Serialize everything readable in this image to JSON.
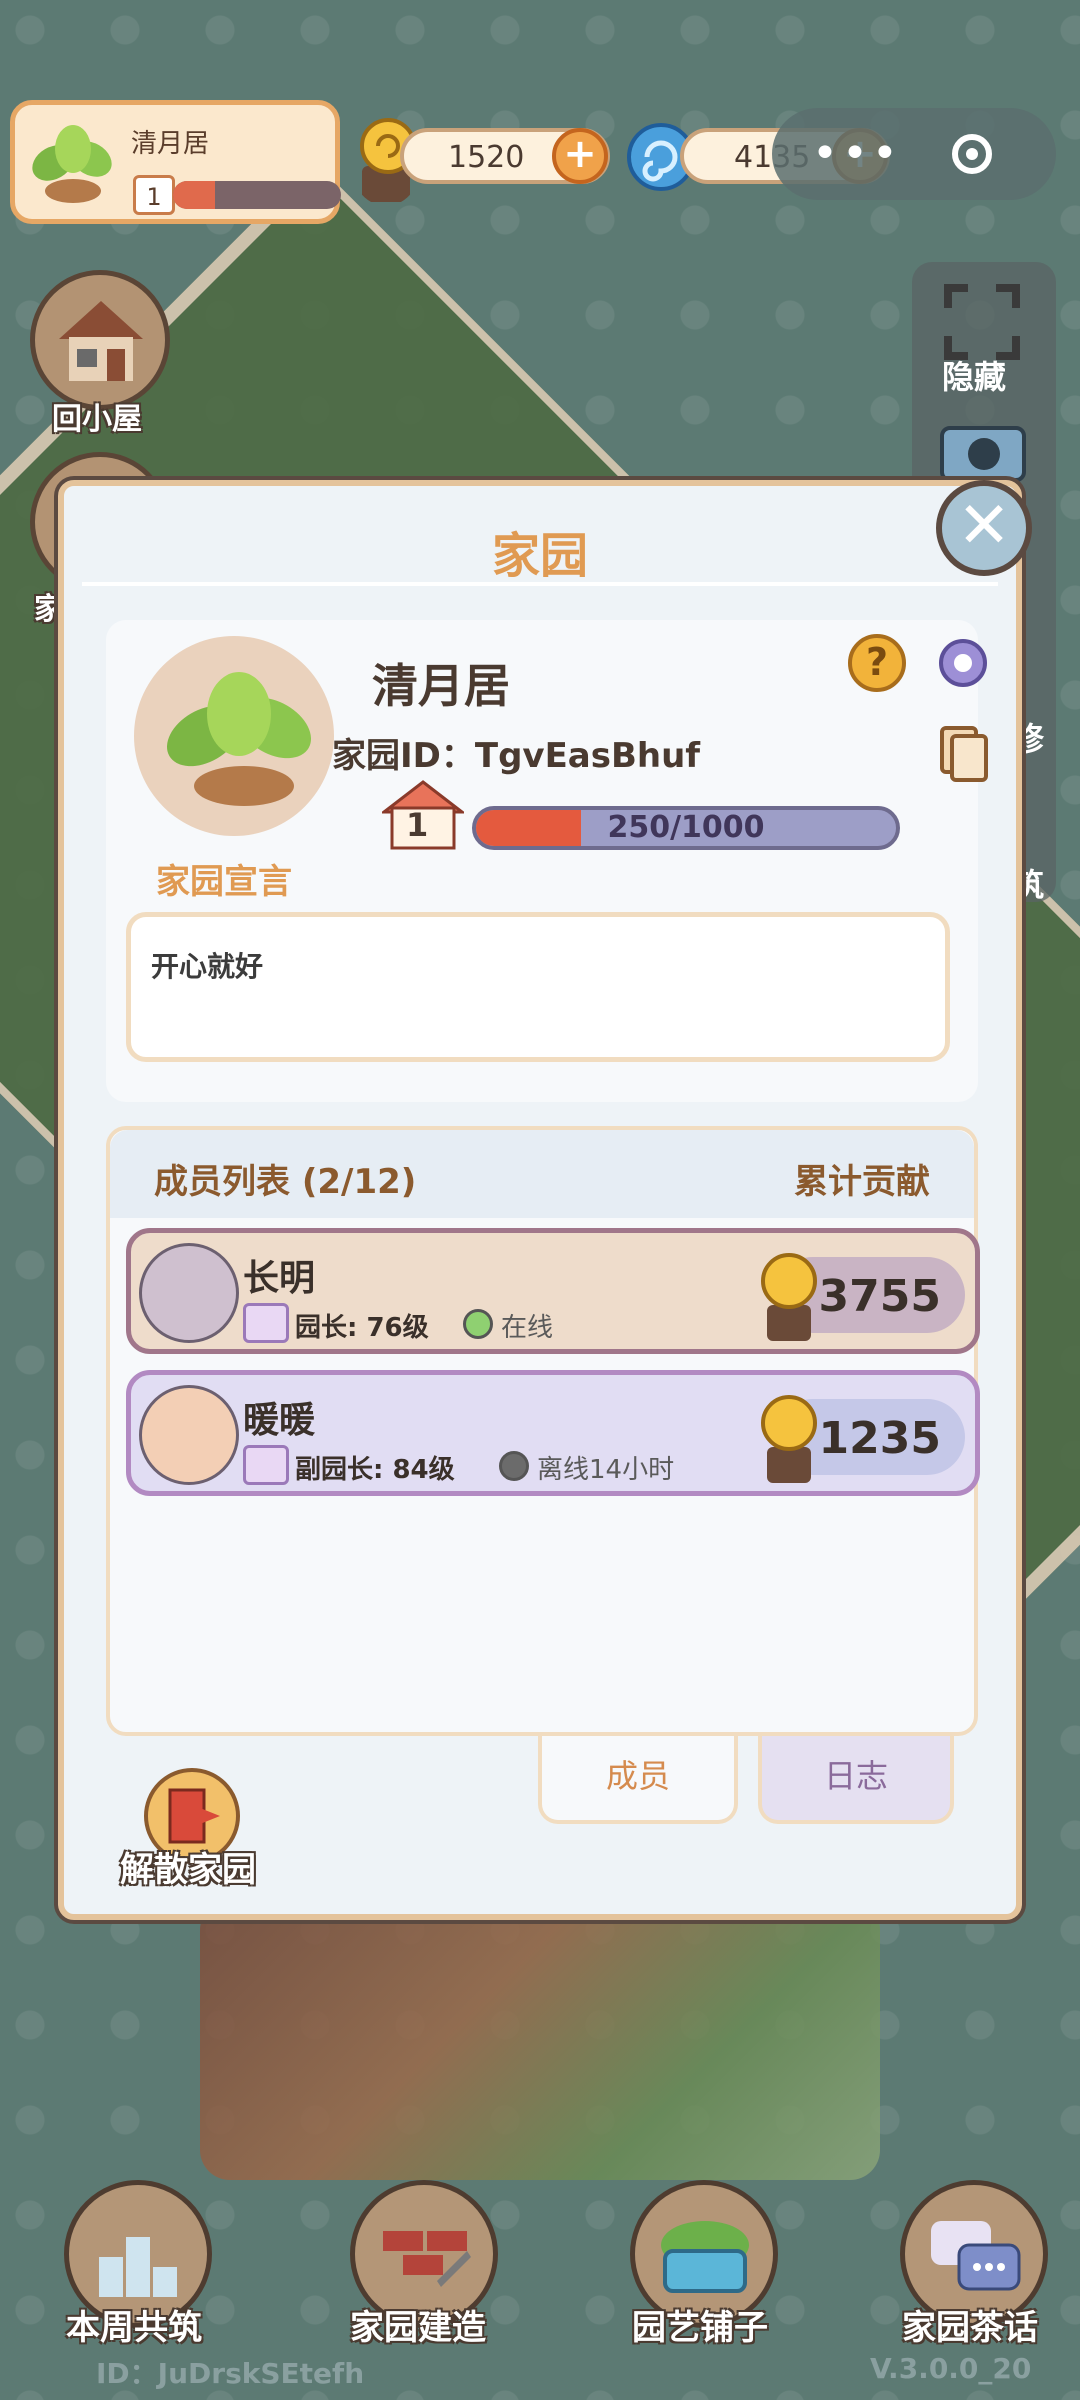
{
  "topbar": {
    "home_name": "清月居",
    "home_level": "1",
    "home_level_progress": 0.25,
    "currency_snail": "1520",
    "currency_swirl": "4135"
  },
  "left_buttons": {
    "back_home": "回小屋",
    "home_short": "家"
  },
  "side_panel": {
    "hide": "隐藏",
    "repair_short": "修",
    "build_short": "筑"
  },
  "dialog": {
    "title": "家园",
    "home_name": "清月居",
    "home_id_label": "家园ID：",
    "home_id": "TgvEasBhuf",
    "level": "1",
    "exp_text": "250/1000",
    "exp_progress": 0.25,
    "declaration_label": "家园宣言",
    "declaration_text": "开心就好"
  },
  "members": {
    "header_left": "成员列表 (2/12)",
    "header_right": "累计贡献",
    "rows": [
      {
        "name": "长明",
        "role": "园长: 76级",
        "status": "在线",
        "contribution": "3755"
      },
      {
        "name": "暖暖",
        "role": "副园长: 84级",
        "status": "离线14小时",
        "contribution": "1235"
      }
    ]
  },
  "tabs": {
    "members": "成员",
    "log": "日志"
  },
  "disband": "解散家园",
  "bottom_nav": [
    {
      "label": "本周共筑"
    },
    {
      "label": "家园建造"
    },
    {
      "label": "园艺铺子"
    },
    {
      "label": "家园茶话"
    }
  ],
  "footer": {
    "id_text": "ID：JuDrskSEtefh",
    "version": "V.3.0.0_20"
  },
  "colors": {
    "accent": "#e09a52",
    "online": "#8fd071",
    "offline": "#6b6b6b"
  }
}
